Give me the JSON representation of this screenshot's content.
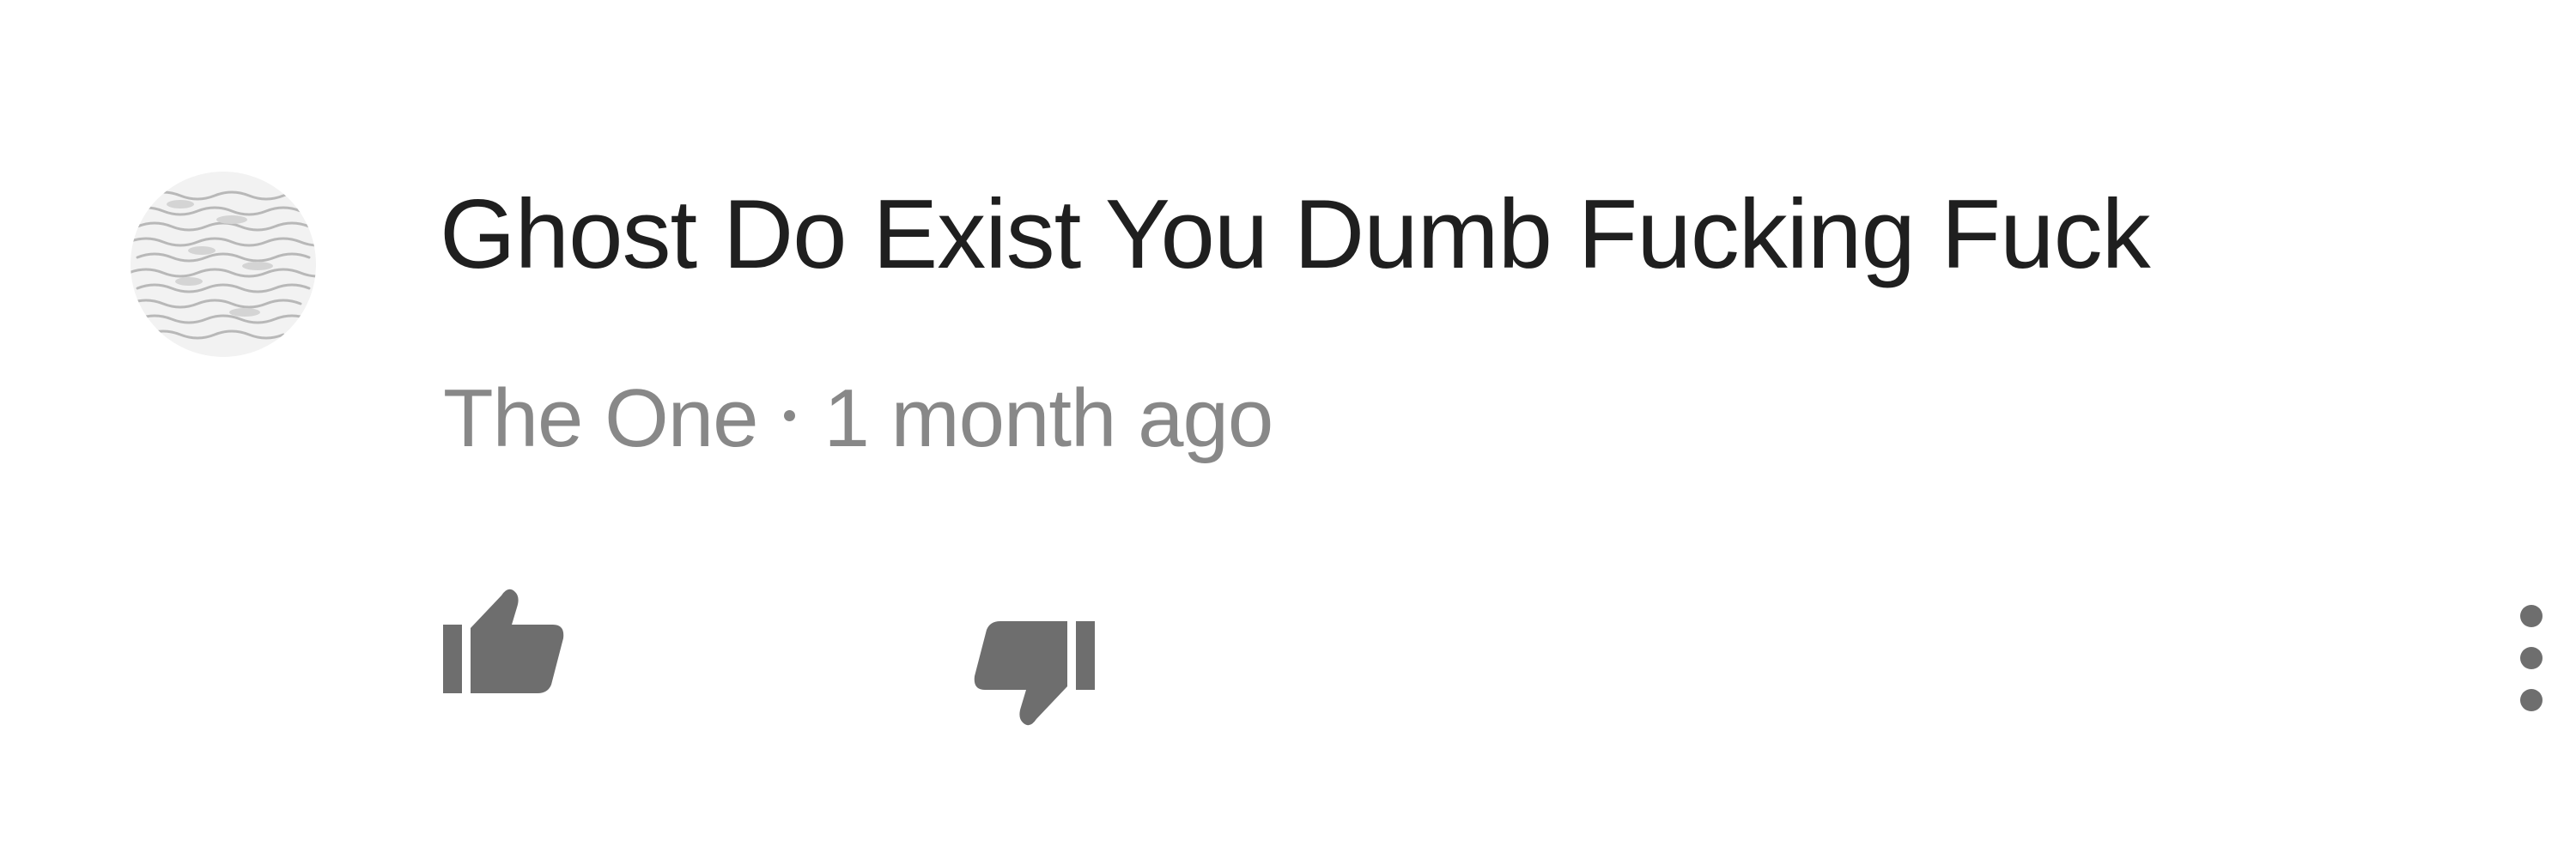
{
  "comment": {
    "text": "Ghost Do Exist You Dumb Fucking Fuck",
    "author": "The One",
    "separator": "•",
    "timestamp": "1 month ago"
  },
  "icons": {
    "avatar": "avatar-image",
    "like": "thumbs-up-icon",
    "dislike": "thumbs-down-icon",
    "more": "more-vertical-icon"
  },
  "colors": {
    "text": "#1f1f1f",
    "meta": "#888888",
    "icon": "#6e6e6e"
  }
}
